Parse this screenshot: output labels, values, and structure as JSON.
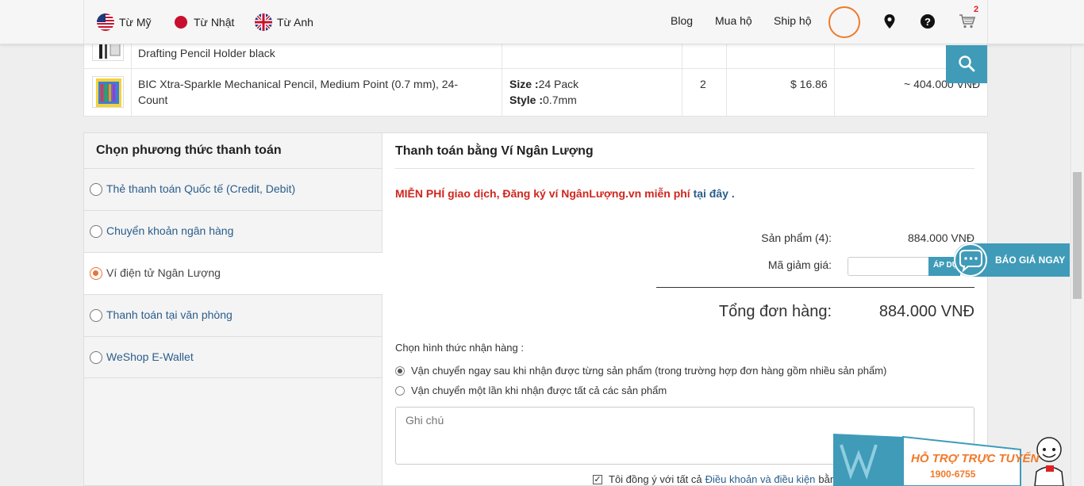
{
  "header": {
    "origins": [
      {
        "label": "Từ Mỹ"
      },
      {
        "label": "Từ Nhật"
      },
      {
        "label": "Từ Anh"
      }
    ],
    "nav": [
      {
        "label": "Blog"
      },
      {
        "label": "Mua hộ"
      },
      {
        "label": "Ship hộ"
      }
    ],
    "icons": [
      "location-pin-icon",
      "help-icon",
      "cart-icon"
    ],
    "cart_count": "2"
  },
  "products": [
    {
      "name": "Drafting Pencil Holder black",
      "size_label": "",
      "size": "",
      "style_label": "",
      "style": "",
      "qty": "",
      "price": "",
      "vnd": ""
    },
    {
      "name": "BIC Xtra-Sparkle Mechanical Pencil, Medium Point (0.7 mm), 24-Count",
      "size_label": "Size :",
      "size": "24 Pack",
      "style_label": "Style :",
      "style": "0.7mm",
      "qty": "2",
      "price": "$ 16.86",
      "vnd": "~ 404.000 VNĐ"
    }
  ],
  "payment": {
    "title": "Chọn phương thức thanh toán",
    "methods": [
      {
        "label": "Thẻ thanh toán Quốc tế (Credit, Debit)",
        "selected": false
      },
      {
        "label": "Chuyển khoản ngân hàng",
        "selected": false
      },
      {
        "label": "Ví điện tử Ngân Lượng",
        "selected": true
      },
      {
        "label": "Thanh toán tại văn phòng",
        "selected": false
      },
      {
        "label": "WeShop E-Wallet",
        "selected": false
      }
    ]
  },
  "detail": {
    "title": "Thanh toán bằng Ví Ngân Lượng",
    "promo_text": "MIỄN PHÍ giao dịch, Đăng ký ví NgânLượng.vn miễn phí",
    "promo_link": "tại đây",
    "promo_end": ".",
    "products_label": "Sản phẩm (4):",
    "products_value": "884.000 VNĐ",
    "coupon_label": "Mã giảm giá:",
    "coupon_value": "",
    "coupon_button": "ÁP DỤNG",
    "total_label": "Tổng đơn hàng:",
    "total_value": "884.000 VNĐ",
    "shipping_title": "Chọn hình thức nhận hàng :",
    "shipping_options": [
      {
        "label": "Vận chuyển ngay sau khi nhận được từng sản phẩm (trong trường hợp đơn hàng gồm nhiều sản phẩm)",
        "selected": true
      },
      {
        "label": "Vận chuyển một lần khi nhận được tất cả các sản phẩm",
        "selected": false
      }
    ],
    "note_placeholder": "Ghi chú",
    "agree_text": "Tôi đồng ý với tất cả",
    "agree_link": "Điều khoản và điều kiện",
    "agree_tail": "bằng"
  },
  "widgets": {
    "quote_button": "BÁO GIÁ NGAY",
    "support_title": "HỖ TRỢ TRỰC TUYẾN",
    "support_phone": "1900-6755"
  },
  "colors": {
    "accent": "#3f9bb8",
    "promo_red": "#d0261e",
    "link_blue": "#2a5d8c",
    "radio_orange": "#e8743a",
    "support_orange": "#f07a2a"
  }
}
